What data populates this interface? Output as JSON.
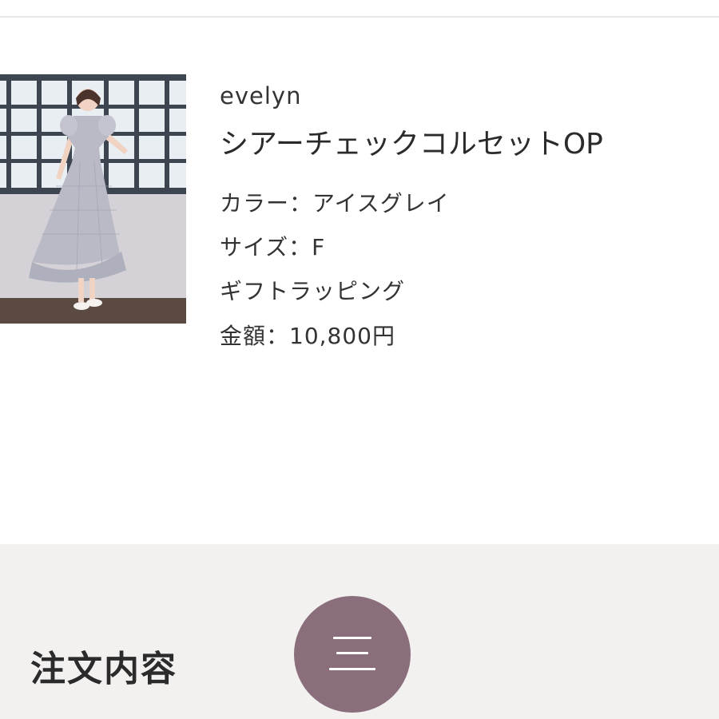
{
  "product": {
    "brand": "evelyn",
    "name": "シアーチェックコルセットOP",
    "color_line": "カラー：アイスグレイ",
    "size_line": "サイズ：F",
    "gift_line": "ギフトラッピング",
    "price_line": "金額：10,800円",
    "image_icon": "product-photo"
  },
  "footer": {
    "section_title": "注文内容",
    "menu_icon": "hamburger-menu-icon"
  },
  "colors": {
    "accent": "#8b6e7c",
    "panel_background": "#f3f1f0",
    "text": "#2b2b2b"
  }
}
